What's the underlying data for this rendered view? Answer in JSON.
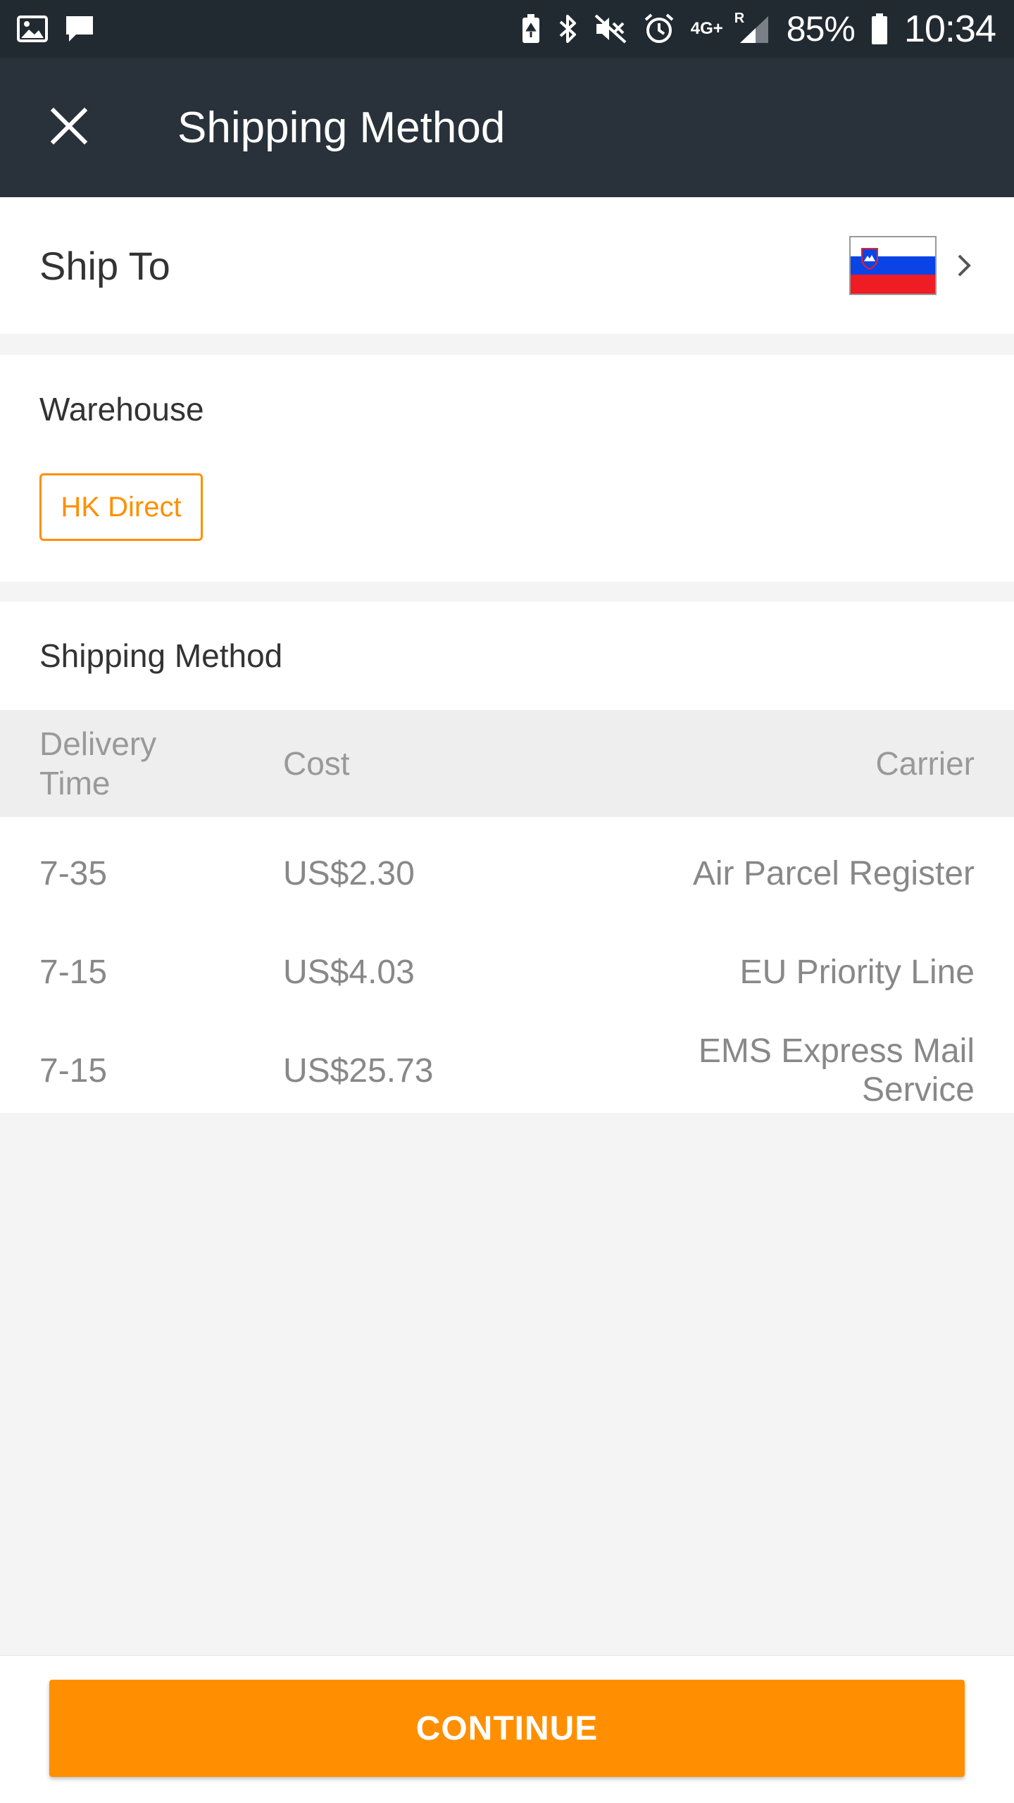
{
  "status_bar": {
    "battery_percent": "85%",
    "time": "10:34",
    "network": "4G+",
    "roaming": "R",
    "left_icons": [
      "gallery-icon",
      "message-icon"
    ],
    "right_icons": [
      "battery-saver-icon",
      "bluetooth-icon",
      "mute-icon",
      "alarm-icon",
      "signal-icon",
      "battery-icon"
    ]
  },
  "app_bar": {
    "title": "Shipping Method",
    "close_icon": "close-icon"
  },
  "ship_to": {
    "label": "Ship To",
    "country_flag": "slovenia-flag",
    "flag_colors": [
      "#ffffff",
      "#0a44e6",
      "#ef1c24"
    ]
  },
  "warehouse": {
    "label": "Warehouse",
    "selected": "HK Direct"
  },
  "shipping_method": {
    "label": "Shipping Method",
    "columns": {
      "delivery_time": "Delivery \n Time",
      "cost": "Cost",
      "carrier": "Carrier"
    },
    "rows": [
      {
        "time": "7-35",
        "cost": "US$2.30",
        "carrier": "Air Parcel Register"
      },
      {
        "time": "7-15",
        "cost": "US$4.03",
        "carrier": "EU Priority Line"
      },
      {
        "time": "7-15",
        "cost": "US$25.73",
        "carrier": "EMS Express Mail Service"
      }
    ]
  },
  "footer": {
    "continue_label": "CONTINUE"
  },
  "colors": {
    "accent": "#ff8f00",
    "app_bar": "#29323a",
    "status_bar": "#222a31"
  }
}
